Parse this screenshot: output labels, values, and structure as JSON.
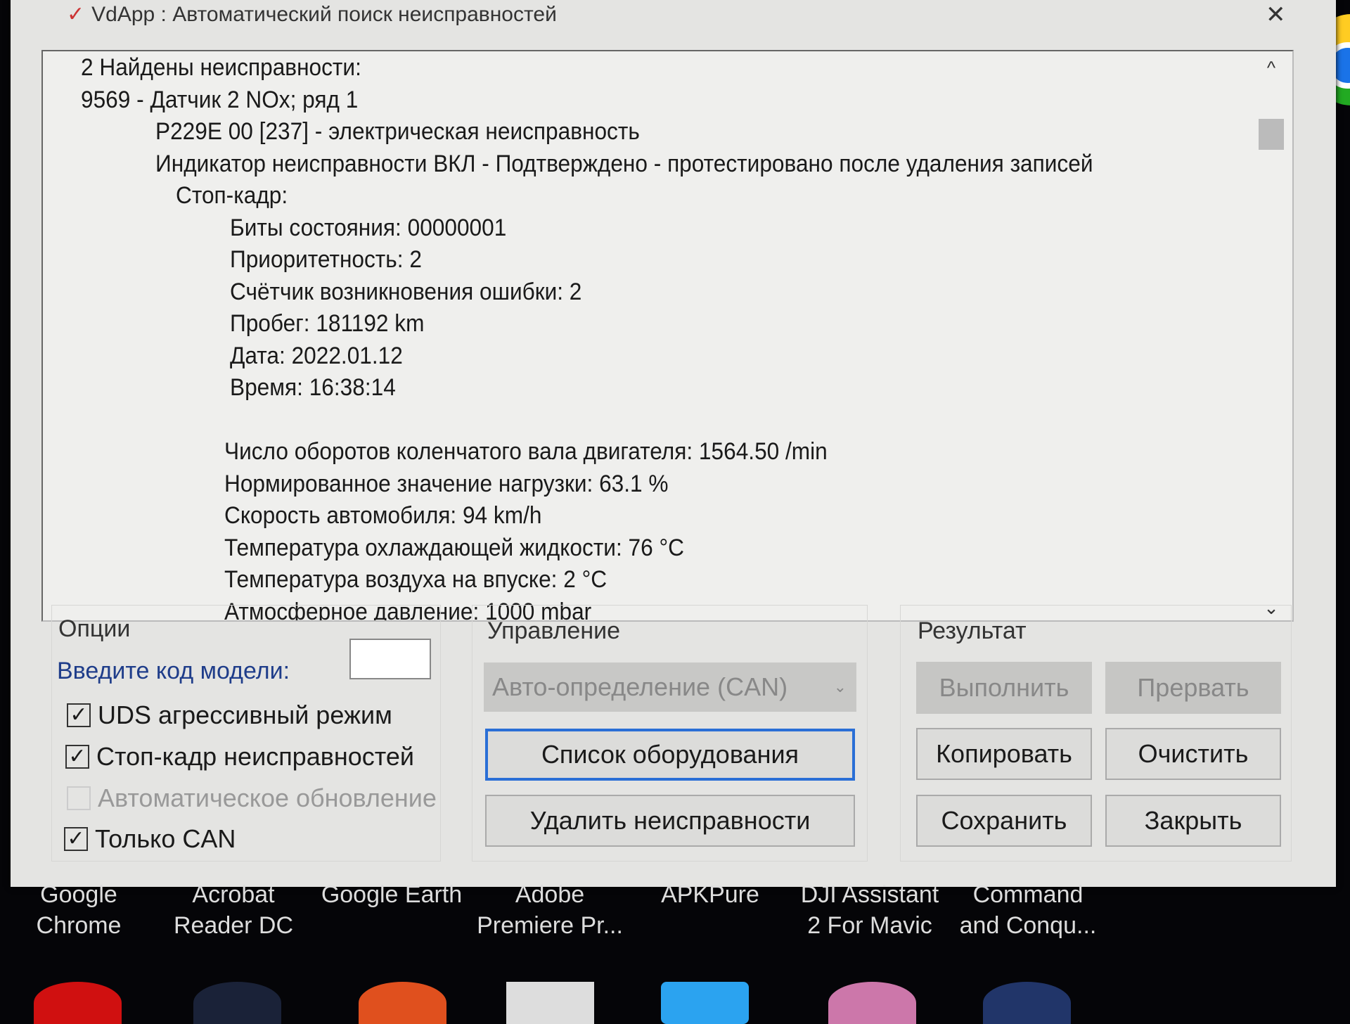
{
  "window": {
    "title": "VdApp : Автоматический поиск неисправностей",
    "close": "✕"
  },
  "log": {
    "lines": [
      {
        "text": "2 Найдены неисправности:",
        "indent": 0
      },
      {
        "text": "9569 - Датчик 2 NOx; ряд 1",
        "indent": 0
      },
      {
        "text": "P229E 00 [237] - электрическая неисправность",
        "indent": 1
      },
      {
        "text": "Индикатор неисправности ВКЛ - Подтверждено - протестировано после удаления записей",
        "indent": 1
      },
      {
        "text": "Стоп-кадр:",
        "indent": 2
      },
      {
        "text": "Биты состояния: 00000001",
        "indent": 3
      },
      {
        "text": "Приоритетность: 2",
        "indent": 3
      },
      {
        "text": "Счётчик возникновения ошибки: 2",
        "indent": 3
      },
      {
        "text": "Пробег: 181192 km",
        "indent": 3
      },
      {
        "text": "Дата: 2022.01.12",
        "indent": 3
      },
      {
        "text": "Время: 16:38:14",
        "indent": 3
      },
      {
        "text": "",
        "indent": 3
      },
      {
        "text": "Число оборотов коленчатого вала двигателя: 1564.50 /min",
        "indent": 3
      },
      {
        "text": "Нормированное значение нагрузки: 63.1 %",
        "indent": 3
      },
      {
        "text": "Скорость автомобиля: 94 km/h",
        "indent": 3
      },
      {
        "text": "Температура охлаждающей жидкости: 76 °C",
        "indent": 3
      },
      {
        "text": "Температура воздуха на впуске: 2 °C",
        "indent": 3
      },
      {
        "text": "Атмосферное давление: 1000 mbar",
        "indent": 3
      }
    ],
    "scroll_up": "^",
    "scroll_down": "⌄"
  },
  "options": {
    "label": "Опции",
    "model_label": "Введите код модели:",
    "model_value": "",
    "checkboxes": [
      {
        "label": "UDS агрессивный режим",
        "checked": true,
        "enabled": true
      },
      {
        "label": "Стоп-кадр неисправностей",
        "checked": true,
        "enabled": true
      },
      {
        "label": "Автоматическое обновление",
        "checked": false,
        "enabled": false
      },
      {
        "label": "Только CAN",
        "checked": true,
        "enabled": true
      }
    ]
  },
  "control": {
    "label": "Управление",
    "dropdown": "Авто-определение (CAN)",
    "equipment": "Список оборудования",
    "clear_faults": "Удалить неисправности"
  },
  "result": {
    "label": "Результат",
    "run": "Выполнить",
    "abort": "Прервать",
    "copy": "Копировать",
    "clear": "Очистить",
    "save": "Сохранить",
    "close": "Закрыть"
  },
  "desktop": {
    "labels": [
      "Google\nChrome",
      "Acrobat\nReader DC",
      "Google Earth",
      "Adobe\nPremiere Pr...",
      "APKPure",
      "DJI Assistant\n2 For Mavic",
      "Command\nand Conqu..."
    ]
  },
  "colors": {
    "accent": "#2a6fd6",
    "model_label": "#1f3d8a"
  }
}
